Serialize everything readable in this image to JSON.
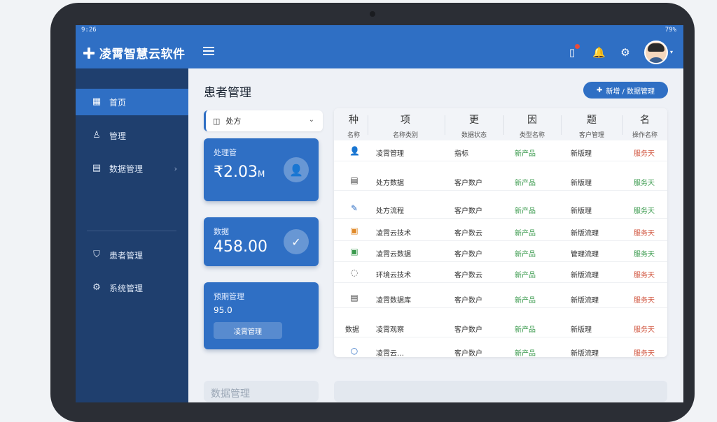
{
  "status": {
    "left": "9:26",
    "right": "79%"
  },
  "app": {
    "title": "凌霄智慧云软件"
  },
  "sidebar": {
    "items": [
      {
        "label": "首页",
        "icon": "grid-icon"
      },
      {
        "label": "管理",
        "icon": "user-icon"
      },
      {
        "label": "数据管理",
        "icon": "doc-icon"
      },
      {
        "label": "患者管理",
        "icon": "shield-icon"
      },
      {
        "label": "系统管理",
        "icon": "gear-icon"
      }
    ]
  },
  "main": {
    "title": "患者管理",
    "action_button": "新增 / 数据管理",
    "filter": "处方",
    "cards": [
      {
        "label": "处理管",
        "value": "₹2.03",
        "unit": "M"
      },
      {
        "label": "数据",
        "value": "458.00"
      },
      {
        "label": "预期管理",
        "sub": "95.0",
        "button": "凌霄管理"
      }
    ],
    "bottom_left": "数据管理"
  },
  "table": {
    "headers": [
      {
        "big": "种",
        "small": "名称"
      },
      {
        "big": "项",
        "small": "名称类别"
      },
      {
        "big": "更",
        "small": "数据状态"
      },
      {
        "big": "因",
        "small": "类型名称"
      },
      {
        "big": "题",
        "small": "客户管理"
      },
      {
        "big": "名",
        "small": "操作名称"
      }
    ],
    "rows": [
      {
        "icon": "👤",
        "name": "凌霄管理",
        "type": "指标",
        "state": "新产品",
        "cat": "新版理",
        "op": "服务天"
      },
      {
        "icon": "▤",
        "name": "处方数据",
        "type": "客户数户",
        "state": "新产品",
        "cat": "新版理",
        "op": "服务天"
      },
      {
        "icon": "✎",
        "name": "处方流程",
        "type": "客户数户",
        "state": "新产品",
        "cat": "新版理",
        "op": "服务天"
      },
      {
        "icon": "▣",
        "name": "凌霄云技术",
        "type": "客户数云",
        "state": "新产品",
        "cat": "新版流理",
        "op": "服务天"
      },
      {
        "icon": "▣",
        "name": "凌霄云数据",
        "type": "客户数户",
        "state": "新产品",
        "cat": "管理流理",
        "op": "服务天"
      },
      {
        "icon": "◌",
        "name": "环境云技术",
        "type": "客户数云",
        "state": "新产品",
        "cat": "新版流理",
        "op": "服务天"
      },
      {
        "icon": "▤",
        "name": "凌霄数据库",
        "type": "客户数户",
        "state": "新产品",
        "cat": "新版流理",
        "op": "服务天"
      },
      {
        "icon": "",
        "name": "凌霄观察",
        "type": "客户数户",
        "state": "新产品",
        "cat": "新版理",
        "op": "服务天",
        "lead": "数据"
      },
      {
        "icon": "○",
        "name": "凌霄云…",
        "type": "客户数户",
        "state": "新产品",
        "cat": "新版流理",
        "op": "服务天"
      }
    ]
  }
}
